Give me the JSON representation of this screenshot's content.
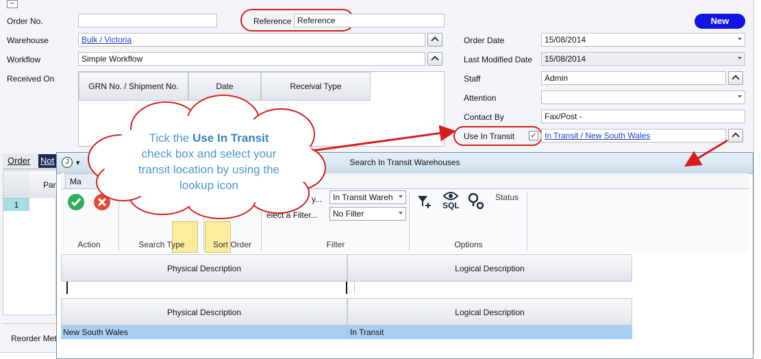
{
  "form": {
    "order_no_label": "Order No.",
    "order_no_value": "",
    "reference_label": "Reference",
    "reference_value": "Reference",
    "new_button": "New",
    "warehouse_label": "Warehouse",
    "warehouse_value": "Bulk / Victoria",
    "workflow_label": "Workflow",
    "workflow_value": "Simple Workflow",
    "received_on_label": "Received On",
    "received_grid": {
      "columns": [
        "GRN No. / Shipment No.",
        "Date",
        "Receival Type"
      ]
    },
    "order_date_label": "Order Date",
    "order_date_value": "15/08/2014",
    "last_modified_label": "Last Modified Date",
    "last_modified_value": "15/08/2014",
    "staff_label": "Staff",
    "staff_value": "Admin",
    "attention_label": "Attention",
    "attention_value": "",
    "contact_by_label": "Contact By",
    "contact_by_value": "Fax/Post -",
    "use_in_transit_label": "Use In Transit",
    "use_in_transit_checked": "✓",
    "in_transit_value": "In Transit / New South Wales",
    "tabs": [
      "Order",
      "Not"
    ],
    "lines_header": "Part",
    "row_number": "1",
    "reorder_label": "Reorder Meth"
  },
  "callout": {
    "line1_pre": "Tick the ",
    "line1_bold": "Use In Transit",
    "line2": "check box and select your",
    "line3": "transit location by using the",
    "line4": "lookup icon"
  },
  "dialog": {
    "title": "Search In Transit Warehouses",
    "app_icon": "J",
    "tab_label": "Ma",
    "ribbon": {
      "action_label": "Action",
      "search_type_label": "Search Type",
      "sort_order_label": "Sort Order",
      "filter_label": "Filter",
      "options_label": "Options",
      "search_by_label": "y...",
      "search_by_value": "In Transit Wareh",
      "select_filter_label": "elect a Filter...",
      "select_filter_value": "No Filter",
      "status_label": "Status",
      "sql_label": "SQL"
    },
    "search_grid": {
      "columns": [
        "Physical Description",
        "Logical Description"
      ],
      "input_value": ""
    },
    "results_grid": {
      "columns": [
        "Physical Description",
        "Logical Description"
      ],
      "rows": [
        {
          "physical": "New South Wales",
          "logical": "In Transit"
        }
      ]
    }
  },
  "colors": {
    "accent_new": "#1414e0",
    "annotation_red": "#d81c1c",
    "callout_text": "#4e97c9",
    "selected_row": "#a9d0f2",
    "link": "#1e3fc9"
  }
}
